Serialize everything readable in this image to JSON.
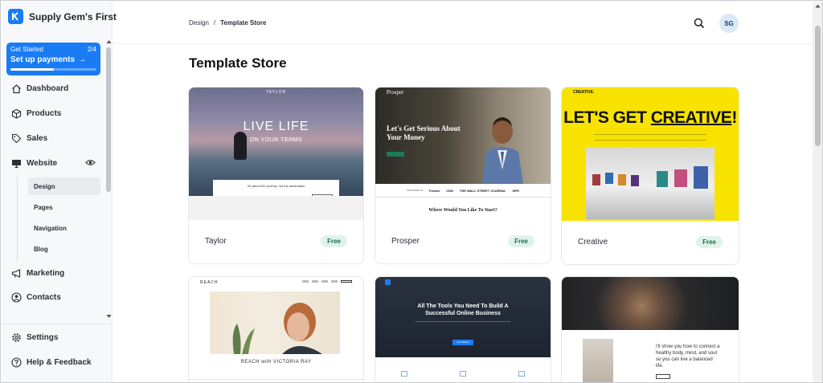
{
  "app": {
    "brand_name": "Supply Gem's First",
    "accent_color": "#1a7cf5"
  },
  "setup": {
    "label": "Get Started",
    "progress_text": "2/4",
    "title": "Set up payments",
    "arrow": "→",
    "progress_fraction": 0.5
  },
  "sidebar": {
    "dashboard": "Dashboard",
    "products": "Products",
    "sales": "Sales",
    "website": "Website",
    "website_sub": [
      "Design",
      "Pages",
      "Navigation",
      "Blog"
    ],
    "marketing": "Marketing",
    "contacts": "Contacts",
    "settings": "Settings",
    "help": "Help & Feedback"
  },
  "header": {
    "breadcrumb_root": "Design",
    "breadcrumb_sep": "/",
    "breadcrumb_current": "Template Store",
    "avatar_initials": "SG"
  },
  "page_title": "Template Store",
  "templates": [
    {
      "name": "Taylor",
      "badge": "Free",
      "preview": {
        "nav": "TAYLOR",
        "headline": "LIVE LIFE",
        "subline": "ON YOUR TERMS",
        "form_text": "It's about the journey, not the destination",
        "button": "SUBSCRIBE"
      }
    },
    {
      "name": "Prosper",
      "badge": "Free",
      "preview": {
        "logo": "Prosper",
        "headline": "Let's Get Serious About Your Money",
        "press": [
          "FEATURED IN",
          "Forbes",
          "CNN",
          "THE WALL STREET JOURNAL",
          "NPR"
        ],
        "question": "Where Would You Like To Start?"
      }
    },
    {
      "name": "Creative",
      "badge": "Free",
      "preview": {
        "logo": "CREATIVE.",
        "headline_plain": "LET'S GET ",
        "headline_underlined": "CREATIVE",
        "headline_end": "!"
      }
    },
    {
      "preview": {
        "nav": "REACH",
        "name_plain": "REACH ",
        "name_italic": "with",
        "name_end": " VICTORIA RAY"
      }
    },
    {
      "preview": {
        "headline": "All The Tools You Need To Build A Successful Online Business",
        "button": "Get Started"
      }
    },
    {
      "preview": {
        "body": "I'll show you how to connect a healthy body, mind, and soul so you can live a balanced life."
      }
    }
  ]
}
